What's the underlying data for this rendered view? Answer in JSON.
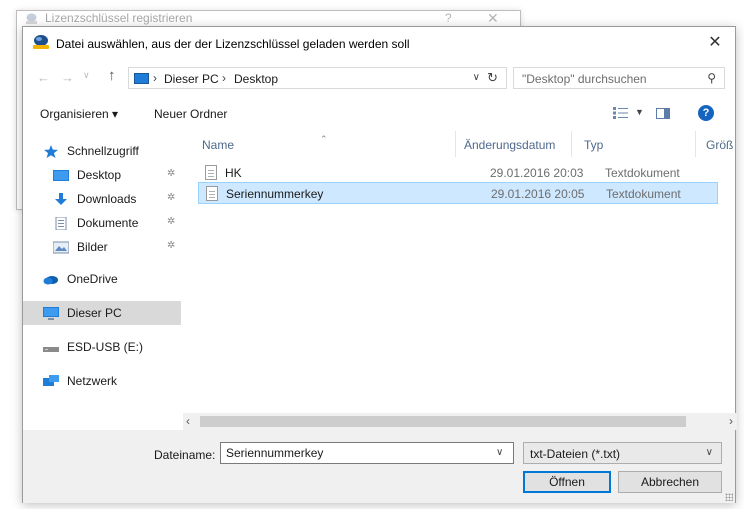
{
  "background_dialog": {
    "title": "Lizenzschlüssel registrieren",
    "help_glyph": "?",
    "close_glyph": "✕"
  },
  "dialog": {
    "title": "Datei auswählen, aus der der Lizenzschlüssel geladen werden soll",
    "close_glyph": "✕"
  },
  "navigation": {
    "back_glyph": "←",
    "forward_glyph": "→",
    "recent_glyph": "∨",
    "up_glyph": "↑",
    "breadcrumb": [
      "Dieser PC",
      "Desktop"
    ],
    "chevron_glyph": "›",
    "dropdown_glyph": "∨",
    "refresh_glyph": "↻",
    "search_placeholder": "\"Desktop\" durchsuchen",
    "search_glyph": "⚲"
  },
  "toolbar": {
    "organize_label": "Organisieren ▾",
    "new_folder_label": "Neuer Ordner",
    "view_dropdown_glyph": "▼",
    "help_glyph": "?"
  },
  "sidebar": {
    "pin_glyph": "✲",
    "items": [
      {
        "label": "Schnellzugriff",
        "icon": "star-icon"
      },
      {
        "label": "Desktop",
        "icon": "desktop-folder-icon",
        "pinned": true
      },
      {
        "label": "Downloads",
        "icon": "download-icon",
        "pinned": true
      },
      {
        "label": "Dokumente",
        "icon": "documents-icon",
        "pinned": true
      },
      {
        "label": "Bilder",
        "icon": "pictures-icon",
        "pinned": true
      },
      {
        "label": "OneDrive",
        "icon": "cloud-icon"
      },
      {
        "label": "Dieser PC",
        "icon": "computer-icon",
        "selected": true
      },
      {
        "label": "ESD-USB (E:)",
        "icon": "drive-icon"
      },
      {
        "label": "Netzwerk",
        "icon": "network-icon"
      }
    ]
  },
  "file_list": {
    "columns": [
      "Name",
      "Änderungsdatum",
      "Typ",
      "Größ"
    ],
    "sort_glyph": "⌃",
    "rows": [
      {
        "name": "HK",
        "date": "29.01.2016 20:03",
        "type": "Textdokument",
        "selected": false
      },
      {
        "name": "Seriennummerkey",
        "date": "29.01.2016 20:05",
        "type": "Textdokument",
        "selected": true
      }
    ]
  },
  "scrollbar": {
    "left_glyph": "‹",
    "right_glyph": "›"
  },
  "bottom": {
    "filename_label": "Dateiname:",
    "filename_value": "Seriennummerkey",
    "filename_drop_glyph": "∨",
    "filetype_value": "txt-Dateien (*.txt)",
    "filetype_drop_glyph": "∨",
    "open_label": "Öffnen",
    "cancel_label": "Abbrechen"
  },
  "colors": {
    "selection_bg": "#cde8ff",
    "selection_border": "#99d1ff",
    "accent": "#0078d7",
    "nav_selected_bg": "#d9d9d9"
  }
}
